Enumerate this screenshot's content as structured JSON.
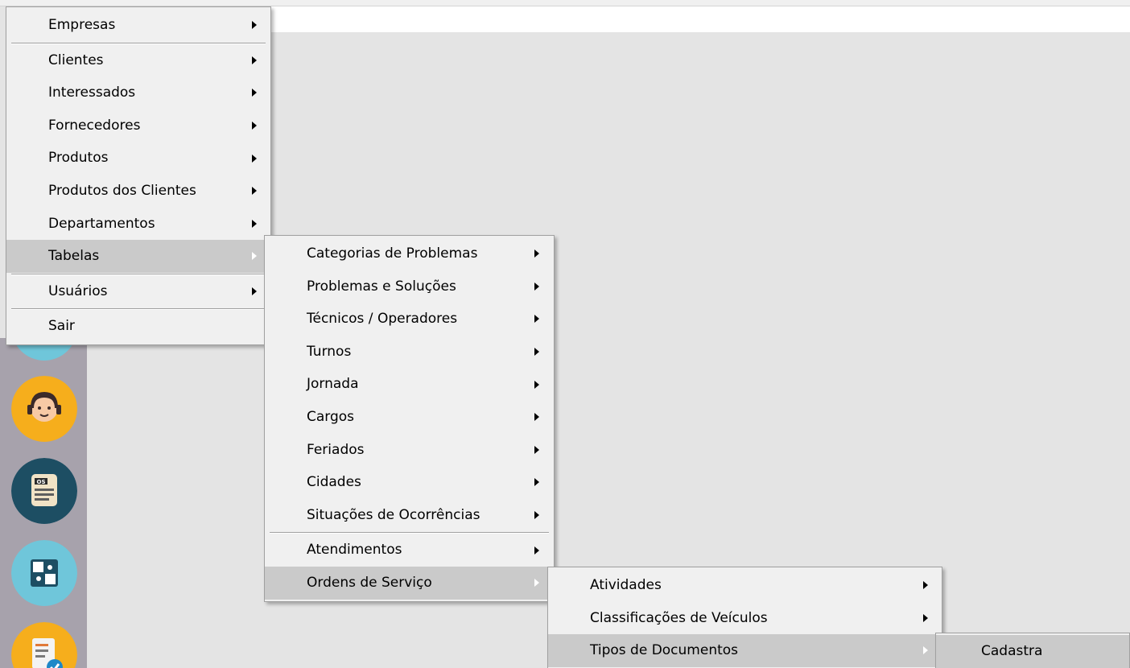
{
  "main_menu": {
    "items": [
      {
        "label": "Empresas"
      },
      {
        "label": "Clientes"
      },
      {
        "label": "Interessados"
      },
      {
        "label": "Fornecedores"
      },
      {
        "label": "Produtos"
      },
      {
        "label": "Produtos dos Clientes"
      },
      {
        "label": "Departamentos"
      },
      {
        "label": "Tabelas"
      },
      {
        "label": "Usuários"
      },
      {
        "label": "Sair"
      }
    ]
  },
  "tabelas_menu": {
    "items": [
      {
        "label": "Categorias de Problemas"
      },
      {
        "label": "Problemas e Soluções"
      },
      {
        "label": "Técnicos / Operadores"
      },
      {
        "label": "Turnos"
      },
      {
        "label": "Jornada"
      },
      {
        "label": "Cargos"
      },
      {
        "label": "Feriados"
      },
      {
        "label": "Cidades"
      },
      {
        "label": "Situações de Ocorrências"
      },
      {
        "label": "Atendimentos"
      },
      {
        "label": "Ordens de Serviço"
      }
    ]
  },
  "ordens_menu": {
    "items": [
      {
        "label": "Atividades"
      },
      {
        "label": "Classificações de Veículos"
      },
      {
        "label": "Tipos de Documentos"
      }
    ]
  },
  "tipos_menu": {
    "items": [
      {
        "label": "Cadastra"
      }
    ]
  },
  "sidebar": {
    "icons": [
      "support-agent-icon",
      "os-document-icon",
      "puzzle-icon",
      "checklist-icon"
    ],
    "os_badge": "OS"
  },
  "colors": {
    "menu_bg": "#f0f0f0",
    "highlight": "#cacaca",
    "sidebar_bg": "#a7a2ac",
    "workspace_bg": "#e4e4e4"
  }
}
